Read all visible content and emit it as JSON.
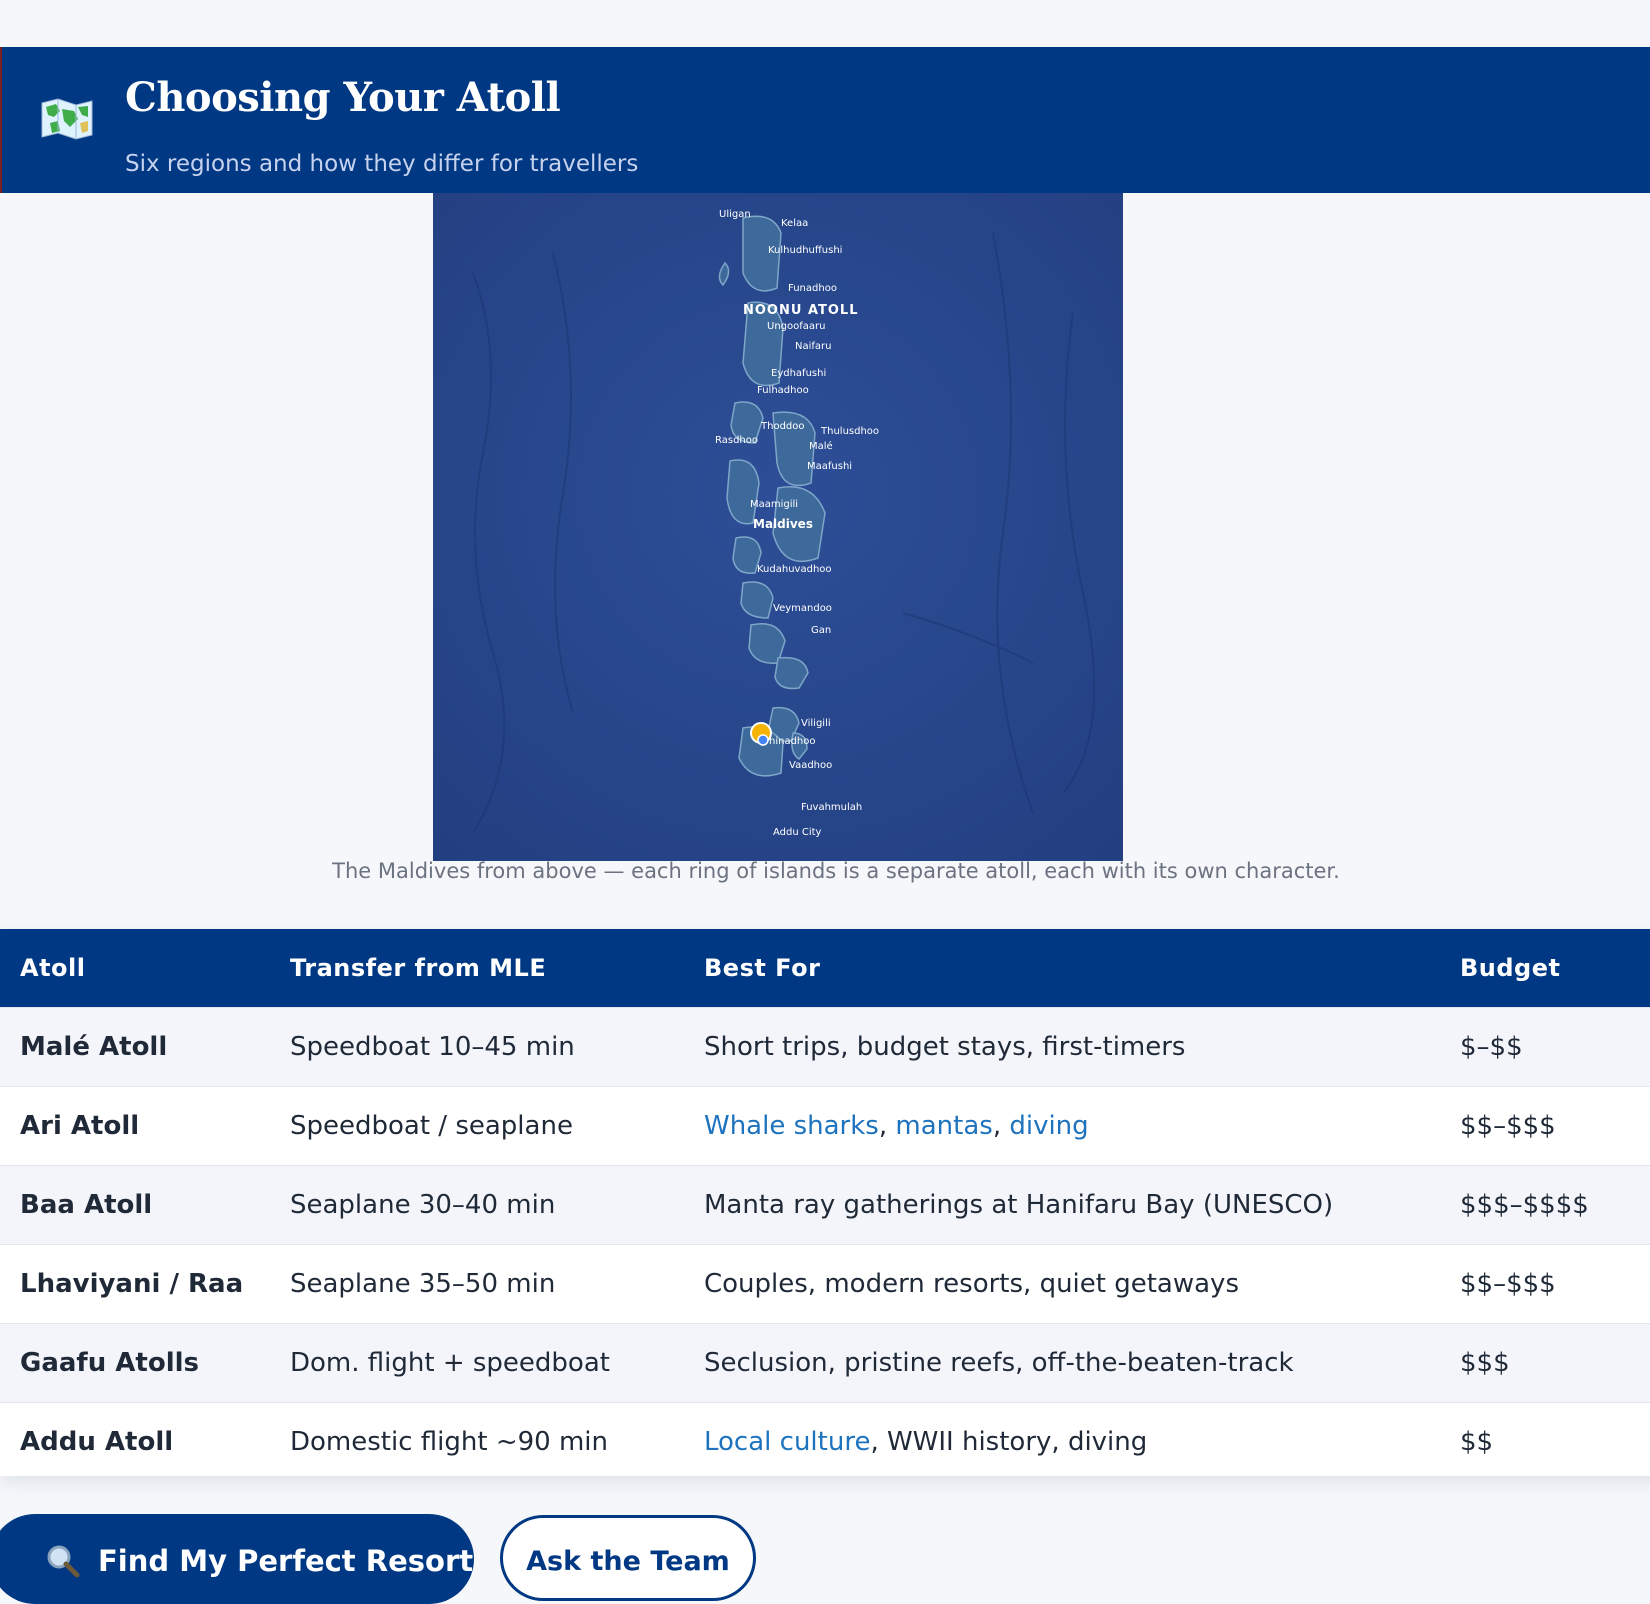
{
  "header": {
    "icon": "world-map-icon",
    "title": "Choosing Your Atoll",
    "subtitle": "Six regions and how they differ for travellers"
  },
  "map": {
    "labels": {
      "uligan": "Uligan",
      "kelaa": "Kelaa",
      "kulhudhuffushi": "Kulhudhuffushi",
      "funadhoo": "Funadhoo",
      "noonu": "NOONU ATOLL",
      "ungoofaaru": "Ungoofaaru",
      "naifaru": "Naifaru",
      "eydhafushi": "Eydhafushi",
      "fulhadhoo": "Fulhadhoo",
      "thoddoo": "Thoddoo",
      "thulusdhoo": "Thulusdhoo",
      "rasdhoo": "Rasdhoo",
      "male": "Malé",
      "maafushi": "Maafushi",
      "maamigili": "Maamigili",
      "maldives": "Maldives",
      "kudahuvadhoo": "Kudahuvadhoo",
      "veymandoo": "Veymandoo",
      "gan": "Gan",
      "viligili": "Viligili",
      "thinadhoo": "hinadhoo",
      "vaadhoo": "Vaadhoo",
      "fuvahmulah": "Fuvahmulah",
      "addu_city": "Addu City"
    }
  },
  "caption": "The Maldives from above — each ring of islands is a separate atoll, each with its own character.",
  "table": {
    "headers": [
      "Atoll",
      "Transfer from MLE",
      "Best For",
      "Budget"
    ],
    "rows": [
      {
        "atoll": "Malé Atoll",
        "transfer": "Speedboat 10–45 min",
        "best_for": "Short trips, budget stays, first-timers",
        "budget": "$–$$"
      },
      {
        "atoll": "Ari Atoll",
        "transfer": "Speedboat / seaplane",
        "best_for_links": [
          "Whale sharks",
          "mantas",
          "diving"
        ],
        "sep": ", ",
        "budget": "$$–$$$"
      },
      {
        "atoll": "Baa Atoll",
        "transfer": "Seaplane 30–40 min",
        "best_for": "Manta ray gatherings at Hanifaru Bay (UNESCO)",
        "budget": "$$$–$$$$"
      },
      {
        "atoll": "Lhaviyani / Raa",
        "transfer": "Seaplane 35–50 min",
        "best_for": "Couples, modern resorts, quiet getaways",
        "budget": "$$–$$$"
      },
      {
        "atoll": "Gaafu Atolls",
        "transfer": "Dom. flight + speedboat",
        "best_for": "Seclusion, pristine reefs, off-the-beaten-track",
        "budget": "$$$"
      },
      {
        "atoll": "Addu Atoll",
        "transfer": "Domestic flight ~90 min",
        "best_for_link": "Local culture",
        "best_for_rest": ", WWII history, diving",
        "budget": "$$"
      }
    ]
  },
  "buttons": {
    "primary": {
      "icon": "magnifier-icon",
      "label": "Find My Perfect Resort"
    },
    "secondary": {
      "label": "Ask the Team"
    }
  },
  "colors": {
    "navy": "#003883",
    "link": "#1e73be",
    "ocean": "#2a4a8f"
  }
}
